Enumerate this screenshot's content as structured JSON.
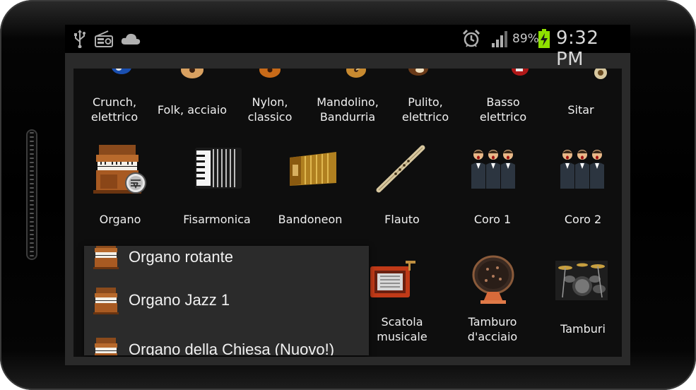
{
  "status_bar": {
    "left_icons": [
      "usb-icon",
      "radio-icon",
      "cloud-icon"
    ],
    "right_icons": [
      "alarm-icon",
      "signal-icon",
      "battery-charging-icon"
    ],
    "battery_percent": "89%",
    "time": "9:32 PM"
  },
  "instruments": {
    "row1": [
      {
        "label": "Crunch, elettrico",
        "icon": "electric-guitar-icon"
      },
      {
        "label": "Folk, acciaio",
        "icon": "acoustic-guitar-icon"
      },
      {
        "label": "Nylon, classico",
        "icon": "classical-guitar-icon"
      },
      {
        "label": "Mandolino, Bandurria",
        "icon": "mandolin-icon"
      },
      {
        "label": "Pulito, elettrico",
        "icon": "clean-guitar-icon"
      },
      {
        "label": "Basso elettrico",
        "icon": "bass-guitar-icon"
      },
      {
        "label": "Sitar",
        "icon": "sitar-icon"
      }
    ],
    "row2": [
      {
        "label": "Organo",
        "icon": "organ-icon"
      },
      {
        "label": "Fisarmonica",
        "icon": "accordion-icon"
      },
      {
        "label": "Bandoneon",
        "icon": "bandoneon-icon"
      },
      {
        "label": "Flauto",
        "icon": "flute-icon"
      },
      {
        "label": "Coro 1",
        "icon": "choir-icon"
      },
      {
        "label": "Coro 2",
        "icon": "choir-icon"
      }
    ],
    "row3": [
      {
        "label": "Scatola musicale",
        "icon": "music-box-icon"
      },
      {
        "label": "Tamburo d'acciaio",
        "icon": "steel-drum-icon"
      },
      {
        "label": "Tamburi",
        "icon": "drum-kit-icon"
      }
    ]
  },
  "organ_dropdown": {
    "items": [
      {
        "label": "Organo rotante",
        "icon": "organ-icon"
      },
      {
        "label": "Organo Jazz 1",
        "icon": "organ-icon"
      },
      {
        "label": "Organo della Chiesa (Nuovo!)",
        "icon": "organ-icon"
      }
    ]
  },
  "colors": {
    "content_bg": "#0e0e0e",
    "frame_bg": "#2a2a2a",
    "dropdown_bg": "#2b2b2b",
    "text": "#f0f0f0",
    "battery_green": "#8ee000"
  }
}
